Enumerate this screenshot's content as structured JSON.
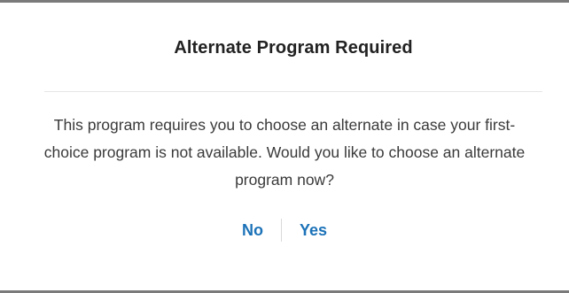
{
  "dialog": {
    "title": "Alternate Program Required",
    "message": "This program requires you to choose an alternate in case your first-choice program is not available. Would you like to choose an alternate program now?",
    "actions": {
      "no_label": "No",
      "yes_label": "Yes"
    },
    "colors": {
      "action_link": "#1b72b8",
      "frame_border": "#7a7a7a"
    }
  }
}
